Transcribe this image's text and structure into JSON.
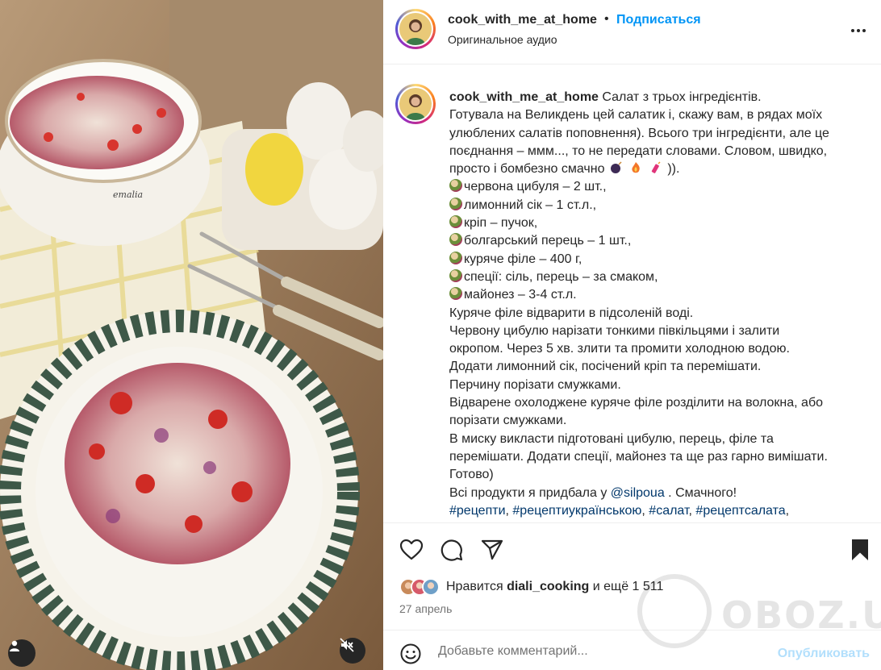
{
  "header": {
    "username": "cook_with_me_at_home",
    "separator": "•",
    "follow_label": "Подписаться",
    "audio_label": "Оригинальное аудио",
    "more_icon": "more-horizontal-icon"
  },
  "caption": {
    "username": "cook_with_me_at_home",
    "intro": "Салат з трьох інгредієнтів.",
    "lines": [
      "Готувала на Великдень цей салатик і, скажу вам, в рядах моїх",
      "улюблених салатів поповнення). Всього три інгредієнти, але це",
      "поєднання – ммм..., то не передати словами. Словом, швидко,",
      "просто і бомбезно смачно"
    ],
    "emoji_tail": ")).",
    "ingredients": [
      "червона цибуля – 2 шт.,",
      "лимонний сік – 1 ст.л.,",
      "кріп – пучок,",
      "болгарський перець – 1 шт.,",
      "куряче філе – 400 г,",
      "спеції: сіль, перець – за смаком,",
      "майонез – 3-4 ст.л."
    ],
    "steps": [
      "Куряче філе відварити в підсоленій воді.",
      "Червону цибулю нарізати тонкими півкільцями і залити",
      "окропом. Через 5 хв. злити та промити холодною водою.",
      "Додати лимонний сік, посічений кріп та перемішати.",
      "Перчину порізати смужками.",
      "Відварене охолоджене куряче філе розділити на волокна, або",
      "порізати смужками.",
      "В миску викласти підготовані цибулю, перець, філе та",
      "перемішати. Додати спеції, майонез та ще раз гарно вимішати.",
      "Готово)"
    ],
    "shop_prefix": "Всі продукти я придбала у ",
    "shop_link": "@silpoua",
    "shop_suffix": " . Смачного!",
    "hashtags": [
      "#рецепти",
      "#рецептиукраїнською",
      "#салат",
      "#рецептсалата"
    ]
  },
  "actions": {
    "like_icon": "heart-icon",
    "comment_icon": "comment-icon",
    "share_icon": "share-icon",
    "save_icon": "bookmark-icon",
    "likes_prefix": "Нравится",
    "likes_user": "diali_cooking",
    "likes_suffix": "и ещё 1 511",
    "date": "27 апрель"
  },
  "comment": {
    "placeholder": "Добавьте комментарий...",
    "publish_label": "Опубликовать",
    "emoji_icon": "smiley-icon"
  },
  "media": {
    "user_icon": "user-tag-icon",
    "mute_icon": "speaker-muted-icon"
  },
  "watermark": {
    "text": "OBOZ.UA"
  },
  "colors": {
    "accent": "#0095f6",
    "link": "#00376b",
    "secondary_text": "#737373",
    "publish_disabled": "#b2dffc"
  }
}
